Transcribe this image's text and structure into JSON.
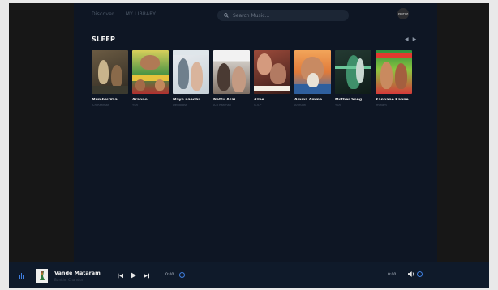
{
  "nav": {
    "discover": "Discover",
    "library": "MY LIBRARY"
  },
  "search": {
    "placeholder": "Search Music..."
  },
  "avatar": {
    "label": "PROFILE"
  },
  "section": {
    "title": "SLEEP"
  },
  "albums": [
    {
      "title": "Mumbai Vaa",
      "artist": "A.R Rahman"
    },
    {
      "title": "Aranno",
      "artist": "YSR"
    },
    {
      "title": "Mayn naadhi",
      "artist": "Devibrash"
    },
    {
      "title": "Nattu Asai",
      "artist": "A.R Rahman"
    },
    {
      "title": "Azhe",
      "artist": "G.V.P"
    },
    {
      "title": "Amma Amma",
      "artist": "Anirudh"
    },
    {
      "title": "Mother Song",
      "artist": "YSR"
    },
    {
      "title": "Kannane Kanne",
      "artist": "Immam"
    }
  ],
  "player": {
    "title": "Vande Mataram",
    "artist": "Bankim Chandra",
    "time_current": "0:00",
    "time_total": "0:00",
    "progress": 0
  },
  "colors": {
    "accent": "#3f7fe0",
    "background": "#0e1624",
    "player": "#0f1a2a"
  }
}
